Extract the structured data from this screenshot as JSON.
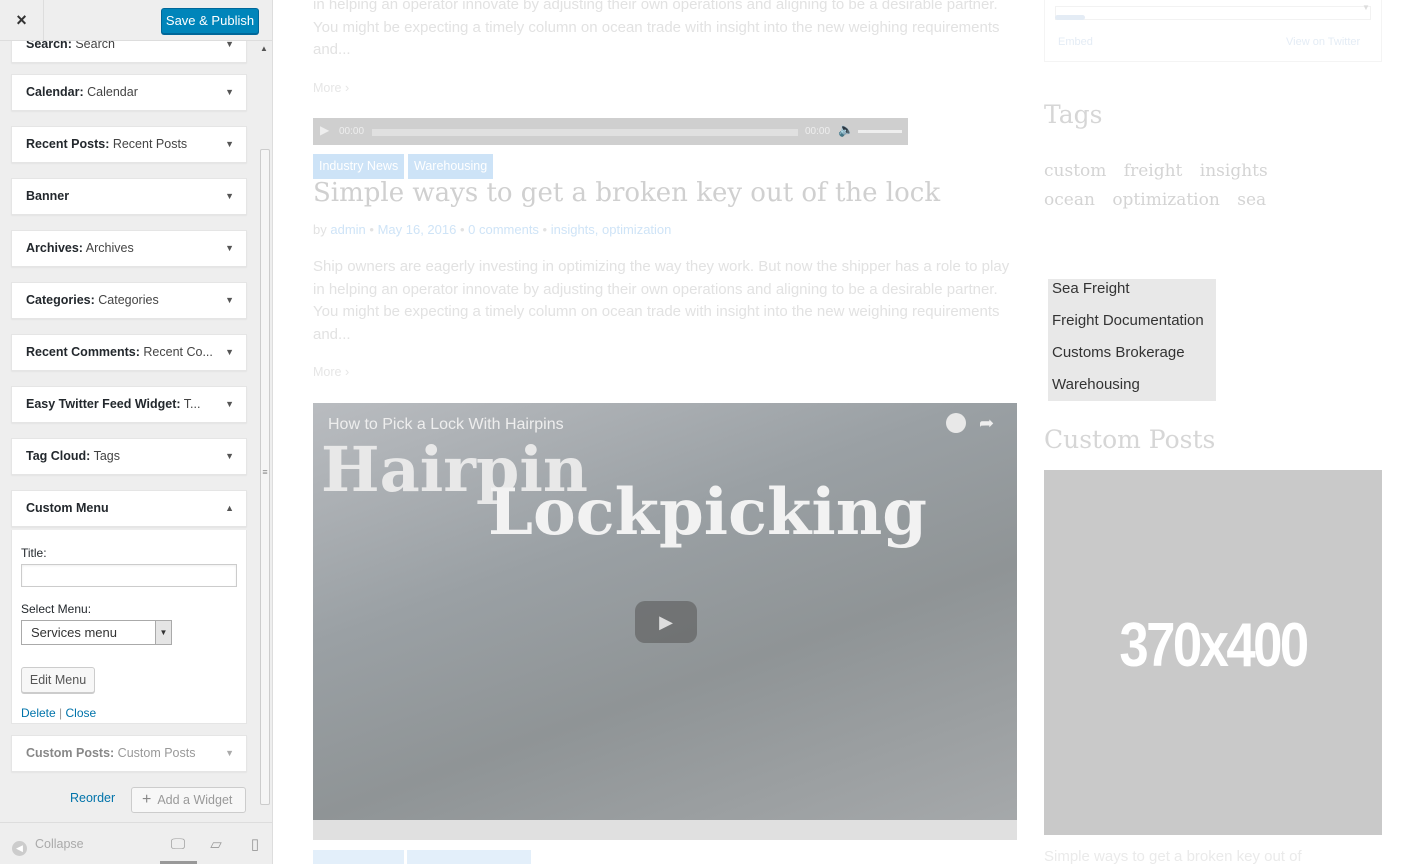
{
  "sidebar": {
    "close_label": "×",
    "save_label": "Save & Publish",
    "widgets": [
      {
        "title": "Search:",
        "sub": " Search"
      },
      {
        "title": "Calendar:",
        "sub": " Calendar"
      },
      {
        "title": "Recent Posts:",
        "sub": " Recent Posts"
      },
      {
        "title": "Banner",
        "sub": ""
      },
      {
        "title": "Archives:",
        "sub": " Archives"
      },
      {
        "title": "Categories:",
        "sub": " Categories"
      },
      {
        "title": "Recent Comments:",
        "sub": " Recent Co..."
      },
      {
        "title": "Easy Twitter Feed Widget:",
        "sub": " T..."
      },
      {
        "title": "Tag Cloud:",
        "sub": " Tags"
      },
      {
        "title": "Custom Menu",
        "sub": ""
      },
      {
        "title": "Custom Posts:",
        "sub": " Custom Posts"
      }
    ],
    "custom_menu_form": {
      "title_label": "Title:",
      "title_value": "",
      "select_label": "Select Menu:",
      "select_value": "Services menu",
      "edit_menu_label": "Edit Menu",
      "delete_label": "Delete",
      "separator": " | ",
      "close_label": "Close"
    },
    "reorder_label": "Reorder",
    "add_widget_label": "Add a Widget",
    "collapse_label": "Collapse",
    "icons": {
      "close": "close-icon",
      "collapse": "collapse-icon",
      "desktop": "desktop-icon",
      "tablet": "tablet-icon",
      "mobile": "mobile-icon",
      "plus": "plus-icon"
    },
    "colors": {
      "accent": "#0085ba",
      "link": "#0073aa"
    }
  },
  "preview": {
    "para_top": "in helping an operator innovate by adjusting their own operations and aligning to be a desirable partner. You might be expecting a timely column on ocean trade with insight into the new weighing requirements and...",
    "more_label": "More",
    "audio": {
      "current": "00:00",
      "duration": "00:00"
    },
    "categories": [
      "Industry News",
      "Warehousing"
    ],
    "post_title": "Simple ways to get a broken key out of the lock",
    "meta": {
      "by": "by",
      "author": "admin",
      "date": "May 16, 2016",
      "comments": "0 comments",
      "tags": "insights, optimization"
    },
    "para2": "Ship owners are eagerly investing in optimizing the way they work. But now the shipper has a role to play in helping an operator innovate by adjusting their own operations and aligning to be a desirable partner. You might be expecting a timely column on ocean trade with insight into the new weighing requirements and...",
    "video": {
      "title": "How to Pick a Lock With Hairpins",
      "line1": "Hairpin",
      "line2": "Lockpicking"
    },
    "twitter": {
      "embed": "Embed",
      "view": "View on Twitter"
    },
    "tags_heading": "Tags",
    "tags": [
      "custom",
      "freight",
      "insights",
      "ocean",
      "optimization",
      "sea"
    ],
    "services_menu": [
      "Sea Freight",
      "Freight Documentation",
      "Customs Brokerage",
      "Warehousing"
    ],
    "custom_posts_heading": "Custom Posts",
    "placeholder_text": "370x400",
    "below_text": "Simple ways to get a broken key out of"
  }
}
